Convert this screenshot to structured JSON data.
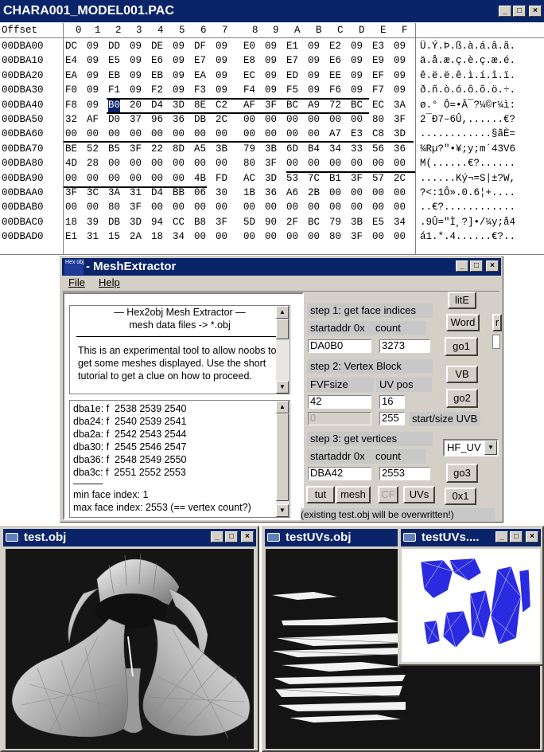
{
  "hex_window": {
    "title": "CHARA001_MODEL001.PAC",
    "header": {
      "offset_label": "Offset",
      "columns": [
        "0",
        "1",
        "2",
        "3",
        "4",
        "5",
        "6",
        "7",
        "8",
        "9",
        "A",
        "B",
        "C",
        "D",
        "E",
        "F"
      ]
    },
    "rows": [
      {
        "offset": "00DBA00",
        "bytes": [
          "DC",
          "09",
          "DD",
          "09",
          "DE",
          "09",
          "DF",
          "09",
          "E0",
          "09",
          "E1",
          "09",
          "E2",
          "09",
          "E3",
          "09"
        ],
        "ascii": "Ü.Ý.Þ.ß.à.á.â.ã."
      },
      {
        "offset": "00DBA10",
        "bytes": [
          "E4",
          "09",
          "E5",
          "09",
          "E6",
          "09",
          "E7",
          "09",
          "E8",
          "09",
          "E7",
          "09",
          "E6",
          "09",
          "E9",
          "09"
        ],
        "ascii": "ä.å.æ.ç.è.ç.æ.é."
      },
      {
        "offset": "00DBA20",
        "bytes": [
          "EA",
          "09",
          "EB",
          "09",
          "EB",
          "09",
          "EA",
          "09",
          "EC",
          "09",
          "ED",
          "09",
          "EE",
          "09",
          "EF",
          "09"
        ],
        "ascii": "ê.ë.ë.ê.ì.í.î.ï."
      },
      {
        "offset": "00DBA30",
        "bytes": [
          "F0",
          "09",
          "F1",
          "09",
          "F2",
          "09",
          "F3",
          "09",
          "F4",
          "09",
          "F5",
          "09",
          "F6",
          "09",
          "F7",
          "09"
        ],
        "ascii": "ð.ñ.ò.ó.ô.õ.ö.÷."
      },
      {
        "offset": "00DBA40",
        "bytes": [
          "F8",
          "09",
          "B0",
          "20",
          "D4",
          "3D",
          "8E",
          "C2",
          "AF",
          "3F",
          "BC",
          "A9",
          "72",
          "BC",
          "EC",
          "3A"
        ],
        "ascii": "ø.° Ô=•Â¯?¼©r¼ì:"
      },
      {
        "offset": "00DBA50",
        "bytes": [
          "32",
          "AF",
          "D0",
          "37",
          "96",
          "36",
          "DB",
          "2C",
          "00",
          "00",
          "00",
          "00",
          "00",
          "00",
          "80",
          "3F"
        ],
        "ascii": "2¯Ð7–6Û,......€?"
      },
      {
        "offset": "00DBA60",
        "bytes": [
          "00",
          "00",
          "00",
          "00",
          "00",
          "00",
          "00",
          "00",
          "00",
          "00",
          "00",
          "00",
          "A7",
          "E3",
          "C8",
          "3D"
        ],
        "ascii": "............§ãÈ="
      },
      {
        "offset": "00DBA70",
        "bytes": [
          "BE",
          "52",
          "B5",
          "3F",
          "22",
          "8D",
          "A5",
          "3B",
          "79",
          "3B",
          "6D",
          "B4",
          "34",
          "33",
          "56",
          "36"
        ],
        "ascii": "¾Rµ?\"•¥;y;m´43V6"
      },
      {
        "offset": "00DBA80",
        "bytes": [
          "4D",
          "28",
          "00",
          "00",
          "00",
          "00",
          "00",
          "00",
          "80",
          "3F",
          "00",
          "00",
          "00",
          "00",
          "00",
          "00"
        ],
        "ascii": "M(......€?......"
      },
      {
        "offset": "00DBA90",
        "bytes": [
          "00",
          "00",
          "00",
          "00",
          "00",
          "00",
          "4B",
          "FD",
          "AC",
          "3D",
          "53",
          "7C",
          "B1",
          "3F",
          "57",
          "2C"
        ],
        "ascii": "......Ký¬=S|±?W,"
      },
      {
        "offset": "00DBAA0",
        "bytes": [
          "3F",
          "3C",
          "3A",
          "31",
          "D4",
          "BB",
          "06",
          "30",
          "1B",
          "36",
          "A6",
          "2B",
          "00",
          "00",
          "00",
          "00"
        ],
        "ascii": "?<:1Ô».0.6¦+...."
      },
      {
        "offset": "00DBAB0",
        "bytes": [
          "00",
          "00",
          "80",
          "3F",
          "00",
          "00",
          "00",
          "00",
          "00",
          "00",
          "00",
          "00",
          "00",
          "00",
          "00",
          "00"
        ],
        "ascii": "..€?............"
      },
      {
        "offset": "00DBAC0",
        "bytes": [
          "18",
          "39",
          "DB",
          "3D",
          "94",
          "CC",
          "B8",
          "3F",
          "5D",
          "90",
          "2F",
          "BC",
          "79",
          "3B",
          "E5",
          "34"
        ],
        "ascii": ".9Û=\"Ì¸?]•/¼y;å4"
      },
      {
        "offset": "00DBAD0",
        "bytes": [
          "E1",
          "31",
          "15",
          "2A",
          "18",
          "34",
          "00",
          "00",
          "00",
          "00",
          "00",
          "00",
          "80",
          "3F",
          "00",
          "00"
        ],
        "ascii": "á1.*.4......€?.."
      }
    ]
  },
  "mesh_window": {
    "title": "MeshExtractor",
    "icon_text": "Hex obj",
    "menu": [
      "File",
      "Help"
    ],
    "info_text": {
      "line1": "—   Hex2obj Mesh Extractor   —",
      "line2": "mesh data files -> *.obj",
      "body": "This is an experimental tool to allow noobs to get some meshes displayed. Use the short tutorial to get a clue on how to proceed."
    },
    "log_lines": [
      "dba1e: f  2538 2539 2540",
      "dba24: f  2540 2539 2541",
      "dba2a: f  2542 2543 2544",
      "dba30: f  2545 2546 2547",
      "dba36: f  2548 2549 2550",
      "dba3c: f  2551 2552 2553",
      "———",
      "min face index: 1",
      "max face index: 2553 (== vertex count?)"
    ],
    "step1": {
      "label": "step 1: get face indices",
      "addr_label": "startaddr 0x",
      "count_label": "count",
      "addr": "DA0B0",
      "count": "3273",
      "go": "go1"
    },
    "step2": {
      "label": "step 2: Vertex Block",
      "fvf_label": "FVFsize",
      "uv_label": "UV pos",
      "fvf": "42",
      "uv": "16",
      "uvb_start": "0",
      "uvb_size": "255",
      "uvb_label": "start/size UVB",
      "go": "go2"
    },
    "step3": {
      "label": "step 3: get vertices",
      "addr_label": "startaddr 0x",
      "count_label": "count",
      "addr": "DBA42",
      "count": "2553",
      "go": "go3"
    },
    "right_buttons": {
      "lite": "litE",
      "word": "Word",
      "vb": "VB",
      "r": "r",
      "x1": "0x1"
    },
    "dropdown": {
      "value": "HF_UV"
    },
    "bottom_buttons": {
      "tut": "tut",
      "mesh": "mesh",
      "cf": "CF",
      "uvs": "UVs"
    },
    "status": "(existing test.obj will be overwritten!)"
  },
  "gl_windows": [
    {
      "title": "test.obj"
    },
    {
      "title": "testUVs.obj"
    },
    {
      "title": "testUVs...."
    }
  ]
}
